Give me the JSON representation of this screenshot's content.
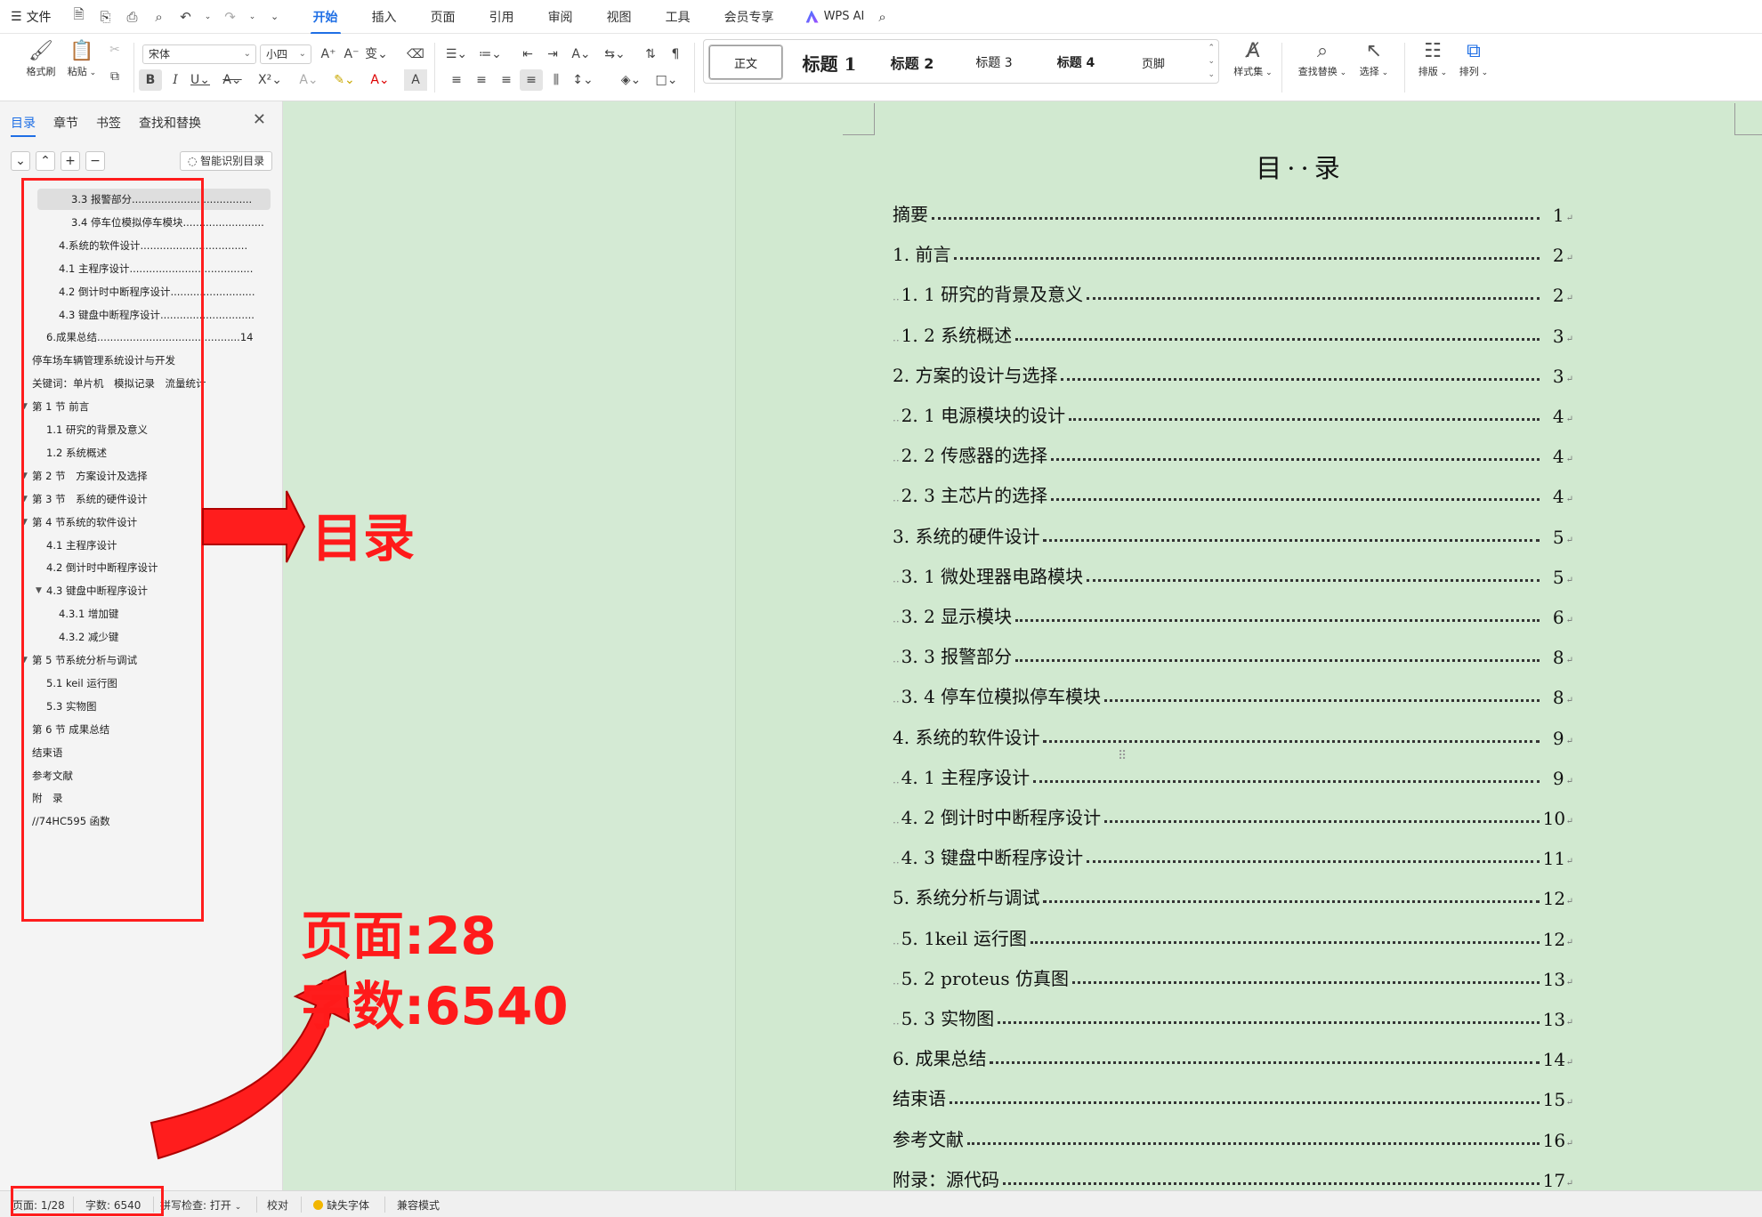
{
  "menubar": {
    "file_label": "文件",
    "tabs": [
      "开始",
      "插入",
      "页面",
      "引用",
      "审阅",
      "视图",
      "工具",
      "会员专享"
    ],
    "active_tab": "开始",
    "wps_ai_label": "WPS AI"
  },
  "ribbon": {
    "format_painter": "格式刷",
    "paste": "粘贴",
    "font_name": "宋体",
    "font_size": "小四",
    "styles": [
      "正文",
      "标题 1",
      "标题 2",
      "标题 3",
      "标题 4",
      "页脚"
    ],
    "style_set": "样式集",
    "find_replace": "查找替换",
    "select": "选择",
    "layout": "排版",
    "arrange": "排列"
  },
  "sidebar": {
    "tabs": [
      "目录",
      "章节",
      "书签",
      "查找和替换"
    ],
    "active_tab": "目录",
    "smart_toc": "智能识别目录",
    "items": [
      {
        "text": "3.3 报警部分.....................................",
        "indent": 4
      },
      {
        "text": "3.4 停车位模拟停车模块.........................",
        "indent": 4
      },
      {
        "text": "4.系统的软件设计.................................",
        "indent": 3
      },
      {
        "text": "4.1 主程序设计......................................",
        "indent": 3
      },
      {
        "text": "4.2 倒计时中断程序设计..........................",
        "indent": 3
      },
      {
        "text": "4.3 键盘中断程序设计.............................",
        "indent": 3
      },
      {
        "text": "6.成果总结............................................14",
        "indent": 2
      },
      {
        "text": "停车场车辆管理系统设计与开发",
        "indent": 1
      },
      {
        "text": "关键词：单片机　模拟记录　流量统计",
        "indent": 1
      },
      {
        "text": "第 1 节 前言",
        "indent": 1,
        "arrow": true
      },
      {
        "text": "1.1 研究的背景及意义",
        "indent": 2
      },
      {
        "text": "1.2 系统概述",
        "indent": 2
      },
      {
        "text": "第 2 节　方案设计及选择",
        "indent": 1,
        "arrow": true
      },
      {
        "text": "第 3 节　系统的硬件设计",
        "indent": 1,
        "arrow": true
      },
      {
        "text": "第 4 节系统的软件设计",
        "indent": 1,
        "arrow": true
      },
      {
        "text": "4.1 主程序设计",
        "indent": 2
      },
      {
        "text": "4.2 倒计时中断程序设计",
        "indent": 2
      },
      {
        "text": "4.3 键盘中断程序设计",
        "indent": 2,
        "arrow": true
      },
      {
        "text": "4.3.1 增加键",
        "indent": 3
      },
      {
        "text": "4.3.2 减少键",
        "indent": 3
      },
      {
        "text": "第 5 节系统分析与调试",
        "indent": 1,
        "arrow": true
      },
      {
        "text": "5.1 keil 运行图",
        "indent": 2
      },
      {
        "text": "5.3 实物图",
        "indent": 2
      },
      {
        "text": "第 6 节 成果总结",
        "indent": 1
      },
      {
        "text": "结束语",
        "indent": 1
      },
      {
        "text": "参考文献",
        "indent": 1
      },
      {
        "text": "附　录",
        "indent": 1
      },
      {
        "text": "//74HC595 函数",
        "indent": 1
      }
    ]
  },
  "document": {
    "toc_title": "目··录",
    "toc": [
      {
        "text": "摘要",
        "page": "1",
        "sub": false
      },
      {
        "text": "1. 前言",
        "page": "2",
        "sub": false
      },
      {
        "text": "1. 1 研究的背景及意义",
        "page": "2",
        "sub": true
      },
      {
        "text": "1. 2 系统概述",
        "page": "3",
        "sub": true
      },
      {
        "text": "2. 方案的设计与选择",
        "page": "3",
        "sub": false
      },
      {
        "text": "2. 1 电源模块的设计",
        "page": "4",
        "sub": true
      },
      {
        "text": "2. 2 传感器的选择",
        "page": "4",
        "sub": true
      },
      {
        "text": "2. 3 主芯片的选择",
        "page": "4",
        "sub": true
      },
      {
        "text": "3. 系统的硬件设计",
        "page": "5",
        "sub": false
      },
      {
        "text": "3. 1 微处理器电路模块",
        "page": "5",
        "sub": true
      },
      {
        "text": "3. 2 显示模块",
        "page": "6",
        "sub": true
      },
      {
        "text": "3. 3 报警部分",
        "page": "8",
        "sub": true
      },
      {
        "text": "3. 4 停车位模拟停车模块",
        "page": "8",
        "sub": true
      },
      {
        "text": "4. 系统的软件设计",
        "page": "9",
        "sub": false
      },
      {
        "text": "4. 1 主程序设计",
        "page": "9",
        "sub": true
      },
      {
        "text": "4. 2 倒计时中断程序设计",
        "page": "10",
        "sub": true
      },
      {
        "text": "4. 3 键盘中断程序设计",
        "page": "11",
        "sub": true
      },
      {
        "text": "5. 系统分析与调试",
        "page": "12",
        "sub": false
      },
      {
        "text": "5. 1keil 运行图",
        "page": "12",
        "sub": true
      },
      {
        "text": "5. 2 proteus 仿真图",
        "page": "13",
        "sub": true
      },
      {
        "text": "5. 3 实物图",
        "page": "13",
        "sub": true
      },
      {
        "text": "6. 成果总结",
        "page": "14",
        "sub": false
      },
      {
        "text": "结束语",
        "page": "15",
        "sub": false
      },
      {
        "text": "参考文献",
        "page": "16",
        "sub": false
      },
      {
        "text": "附录：源代码",
        "page": "17",
        "sub": false
      }
    ]
  },
  "annotations": {
    "toc_label": "目录",
    "pages_line": "页面:28",
    "words_line": "字数:6540"
  },
  "statusbar": {
    "page": "页面: 1/28",
    "words": "字数: 6540",
    "spellcheck": "拼写检查: 打开",
    "proofread": "校对",
    "missing_font": "缺失字体",
    "compat_mode": "兼容模式"
  },
  "colors": {
    "accent": "#1f6fe5",
    "annotation_red": "#ff1a1a",
    "page_bg": "#d1e9d0"
  }
}
